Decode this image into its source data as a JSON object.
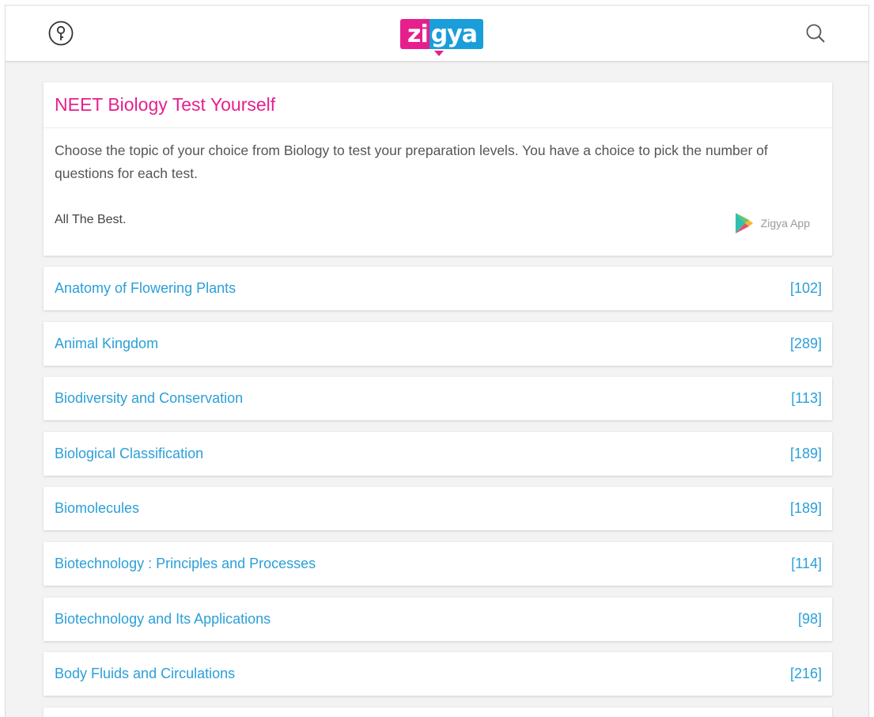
{
  "header": {
    "left_icon": "key-icon",
    "logo_text_left": "zi",
    "logo_text_right": "gya",
    "right_icon": "search-icon",
    "colors": {
      "brand_pink": "#e61f8c",
      "brand_blue": "#1a9ed9"
    }
  },
  "intro": {
    "title": "NEET Biology Test Yourself",
    "description": "Choose the topic of your choice from Biology to test your preparation levels. You have a choice to pick the number of questions for each test.",
    "signoff": "All The Best.",
    "app_icon": "play-store-icon",
    "app_label": "Zigya App"
  },
  "topics": [
    {
      "name": "Anatomy of Flowering Plants",
      "count": "[102]"
    },
    {
      "name": "Animal Kingdom",
      "count": "[289]"
    },
    {
      "name": "Biodiversity and Conservation",
      "count": "[113]"
    },
    {
      "name": "Biological Classification",
      "count": "[189]"
    },
    {
      "name": "Biomolecules",
      "count": "[189]"
    },
    {
      "name": "Biotechnology : Principles and Processes",
      "count": "[114]"
    },
    {
      "name": "Biotechnology and Its Applications",
      "count": "[98]"
    },
    {
      "name": "Body Fluids and Circulations",
      "count": "[216]"
    }
  ],
  "colors": {
    "title_pink": "#e6208e",
    "link_blue": "#2b9fd8"
  }
}
